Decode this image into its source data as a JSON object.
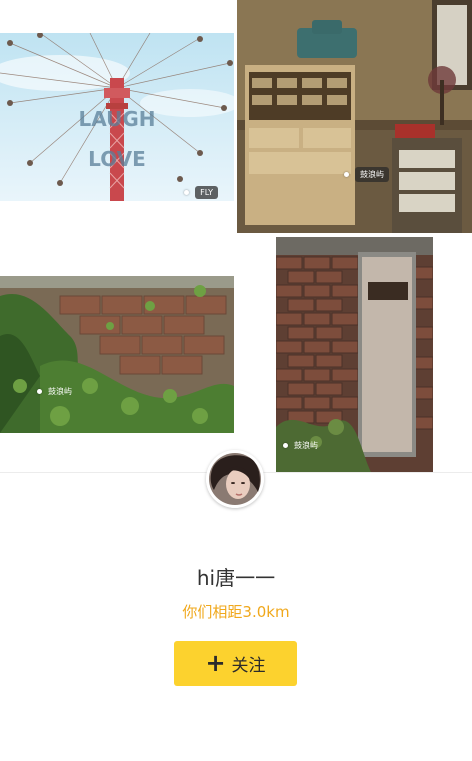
{
  "gallery": {
    "photos": [
      {
        "subject": "swing-ride",
        "sign_text": [
          "LAUGH",
          "LOVE"
        ],
        "tag": "FLY"
      },
      {
        "subject": "vintage-desk",
        "tag": "鼓浪屿"
      },
      {
        "subject": "overgrown-wall",
        "tag": "鼓浪屿"
      },
      {
        "subject": "rusty-door",
        "tag": "鼓浪屿"
      }
    ]
  },
  "profile": {
    "name": "hi唐一一",
    "distance": "你们相距3.0km",
    "follow_label": "关注",
    "follow_icon": "plus-icon"
  },
  "colors": {
    "accent": "#f0a81c",
    "button": "#fcd22e"
  }
}
